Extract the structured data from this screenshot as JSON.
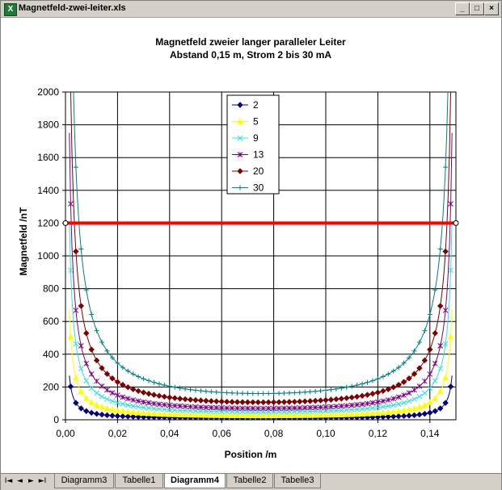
{
  "window": {
    "title": "Magnetfeld-zwei-leiter.xls",
    "icon": "excel-icon",
    "controls": [
      "_",
      "□",
      "×"
    ]
  },
  "sheet_tabs": [
    {
      "label": "Diagramm3",
      "active": false
    },
    {
      "label": "Tabelle1",
      "active": false
    },
    {
      "label": "Diagramm4",
      "active": true
    },
    {
      "label": "Tabelle2",
      "active": false
    },
    {
      "label": "Tabelle3",
      "active": false
    }
  ],
  "nav_buttons": [
    "I◄",
    "◄",
    "►",
    "►I"
  ],
  "chart_data": {
    "type": "line",
    "title": "Magnetfeld zweier langer paralleler Leiter",
    "subtitle": "Abstand 0,15 m,    Strom 2 bis 30 mA",
    "xlabel": "Position /m",
    "ylabel": "Magnetfeld /nT",
    "xlim": [
      0,
      0.15
    ],
    "ylim": [
      0,
      2000
    ],
    "xticks": [
      "0,00",
      "0,02",
      "0,04",
      "0,06",
      "0,08",
      "0,10",
      "0,12",
      "0,14"
    ],
    "yticks": [
      "0",
      "200",
      "400",
      "600",
      "800",
      "1000",
      "1200",
      "1400",
      "1600",
      "1800",
      "2000"
    ],
    "grid": true,
    "legend_position": "top-center",
    "conductor_separation_m": 0.15,
    "threshold_line": {
      "y": 1200,
      "color": "#ff0000"
    },
    "series": [
      {
        "name": "2",
        "current_mA": 2,
        "color": "#000080",
        "marker": "diamond"
      },
      {
        "name": "5",
        "current_mA": 5,
        "color": "#ffff00",
        "marker": "triangle"
      },
      {
        "name": "9",
        "current_mA": 9,
        "color": "#33e0e0",
        "marker": "cross"
      },
      {
        "name": "13",
        "current_mA": 13,
        "color": "#800080",
        "marker": "star"
      },
      {
        "name": "20",
        "current_mA": 20,
        "color": "#800000",
        "marker": "diamond"
      },
      {
        "name": "30",
        "current_mA": 30,
        "color": "#008080",
        "marker": "plus"
      }
    ]
  }
}
